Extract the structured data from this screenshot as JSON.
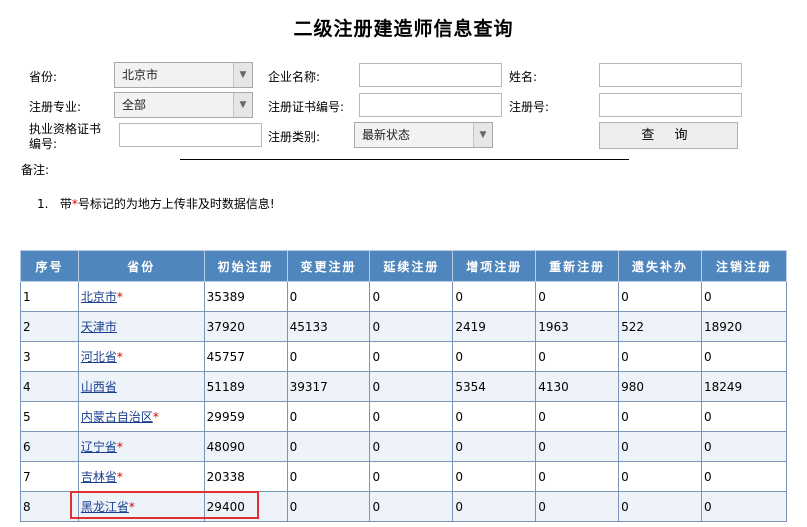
{
  "title": "二级注册建造师信息查询",
  "form": {
    "province_label": "省份:",
    "province_value": "北京市",
    "company_label": "企业名称:",
    "name_label": "姓名:",
    "specialty_label": "注册专业:",
    "specialty_value": "全部",
    "cert_no_label": "注册证书编号:",
    "reg_no_label": "注册号:",
    "qual_label_line1": "执业资格证书",
    "qual_label_line2": "编号:",
    "type_label": "注册类别:",
    "type_value": "最新状态",
    "query_button": "查 询"
  },
  "note": {
    "label": "备注:",
    "index": "1.",
    "text_before": "带",
    "star": "*",
    "text_after": "号标记的为地方上传非及时数据信息!"
  },
  "table": {
    "headers": [
      "序号",
      "省份",
      "初始注册",
      "变更注册",
      "延续注册",
      "增项注册",
      "重新注册",
      "遗失补办",
      "注销注册"
    ],
    "rows": [
      {
        "no": "1",
        "province": "北京市",
        "star": "*",
        "c1": "35389",
        "c2": "0",
        "c3": "0",
        "c4": "0",
        "c5": "0",
        "c6": "0",
        "c7": "0"
      },
      {
        "no": "2",
        "province": "天津市",
        "star": "",
        "c1": "37920",
        "c2": "45133",
        "c3": "0",
        "c4": "2419",
        "c5": "1963",
        "c6": "522",
        "c7": "18920"
      },
      {
        "no": "3",
        "province": "河北省",
        "star": "*",
        "c1": "45757",
        "c2": "0",
        "c3": "0",
        "c4": "0",
        "c5": "0",
        "c6": "0",
        "c7": "0"
      },
      {
        "no": "4",
        "province": "山西省",
        "star": "",
        "c1": "51189",
        "c2": "39317",
        "c3": "0",
        "c4": "5354",
        "c5": "4130",
        "c6": "980",
        "c7": "18249"
      },
      {
        "no": "5",
        "province": "内蒙古自治区",
        "star": "*",
        "c1": "29959",
        "c2": "0",
        "c3": "0",
        "c4": "0",
        "c5": "0",
        "c6": "0",
        "c7": "0"
      },
      {
        "no": "6",
        "province": "辽宁省",
        "star": "*",
        "c1": "48090",
        "c2": "0",
        "c3": "0",
        "c4": "0",
        "c5": "0",
        "c6": "0",
        "c7": "0"
      },
      {
        "no": "7",
        "province": "吉林省",
        "star": "*",
        "c1": "20338",
        "c2": "0",
        "c3": "0",
        "c4": "0",
        "c5": "0",
        "c6": "0",
        "c7": "0"
      },
      {
        "no": "8",
        "province": "黑龙江省",
        "star": "*",
        "c1": "29400",
        "c2": "0",
        "c3": "0",
        "c4": "0",
        "c5": "0",
        "c6": "0",
        "c7": "0"
      }
    ]
  },
  "colors": {
    "header_bg": "#4f86bd",
    "link": "#1a3f8f",
    "highlight": "#e03030"
  }
}
